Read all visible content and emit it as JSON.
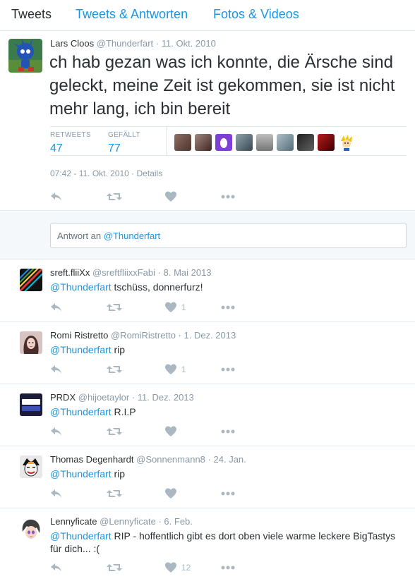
{
  "tabs": [
    "Tweets",
    "Tweets & Antworten",
    "Fotos & Videos"
  ],
  "main_tweet": {
    "name": "Lars Cloos",
    "handle": "@Thunderfart",
    "sep": "·",
    "date": "11. Okt. 2010",
    "text": "ch hab gezan was ich konnte, die Ärsche sind geleckt, meine Zeit ist gekommen, sie ist nicht mehr lang, ich bin bereit",
    "retweets_label": "RETWEETS",
    "retweets": "47",
    "likes_label": "GEFÄLLT",
    "likes": "77",
    "timestamp": "07:42 - 11. Okt. 2010 · Details"
  },
  "reply_box": {
    "prefix": "Antwort an ",
    "mention": "@Thunderfart"
  },
  "replies": [
    {
      "name": "sreft.fliiXx",
      "handle": "@sreftfliixxFabi",
      "sep": "·",
      "date": "8. Mai 2013",
      "mention": "@Thunderfart",
      "text": " tschüss, donnerfurz!",
      "like_count": "1"
    },
    {
      "name": "Romi Ristretto",
      "handle": "@RomiRistretto",
      "sep": "·",
      "date": "1. Dez. 2013",
      "mention": "@Thunderfart",
      "text": " rip",
      "like_count": "1"
    },
    {
      "name": "PRDX",
      "handle": "@hijoetaylor",
      "sep": "·",
      "date": "11. Dez. 2013",
      "mention": "@Thunderfart",
      "text": " R.I.P",
      "like_count": ""
    },
    {
      "name": "Thomas Degenhardt",
      "handle": "@Sonnenmann8",
      "sep": "·",
      "date": "24. Jan.",
      "mention": "@Thunderfart",
      "text": " rip",
      "like_count": ""
    },
    {
      "name": "Lennyficate",
      "handle": "@Lennyficate",
      "sep": "·",
      "date": "6. Feb.",
      "mention": "@Thunderfart",
      "text": " RIP - hoffentlich gibt es dort oben viele warme leckere BigTastys für dich... :(",
      "like_count": "12"
    }
  ],
  "colors": {
    "link": "#1b95e0",
    "muted": "#8899a6",
    "icon": "#aab8c2",
    "text": "#292f33"
  }
}
